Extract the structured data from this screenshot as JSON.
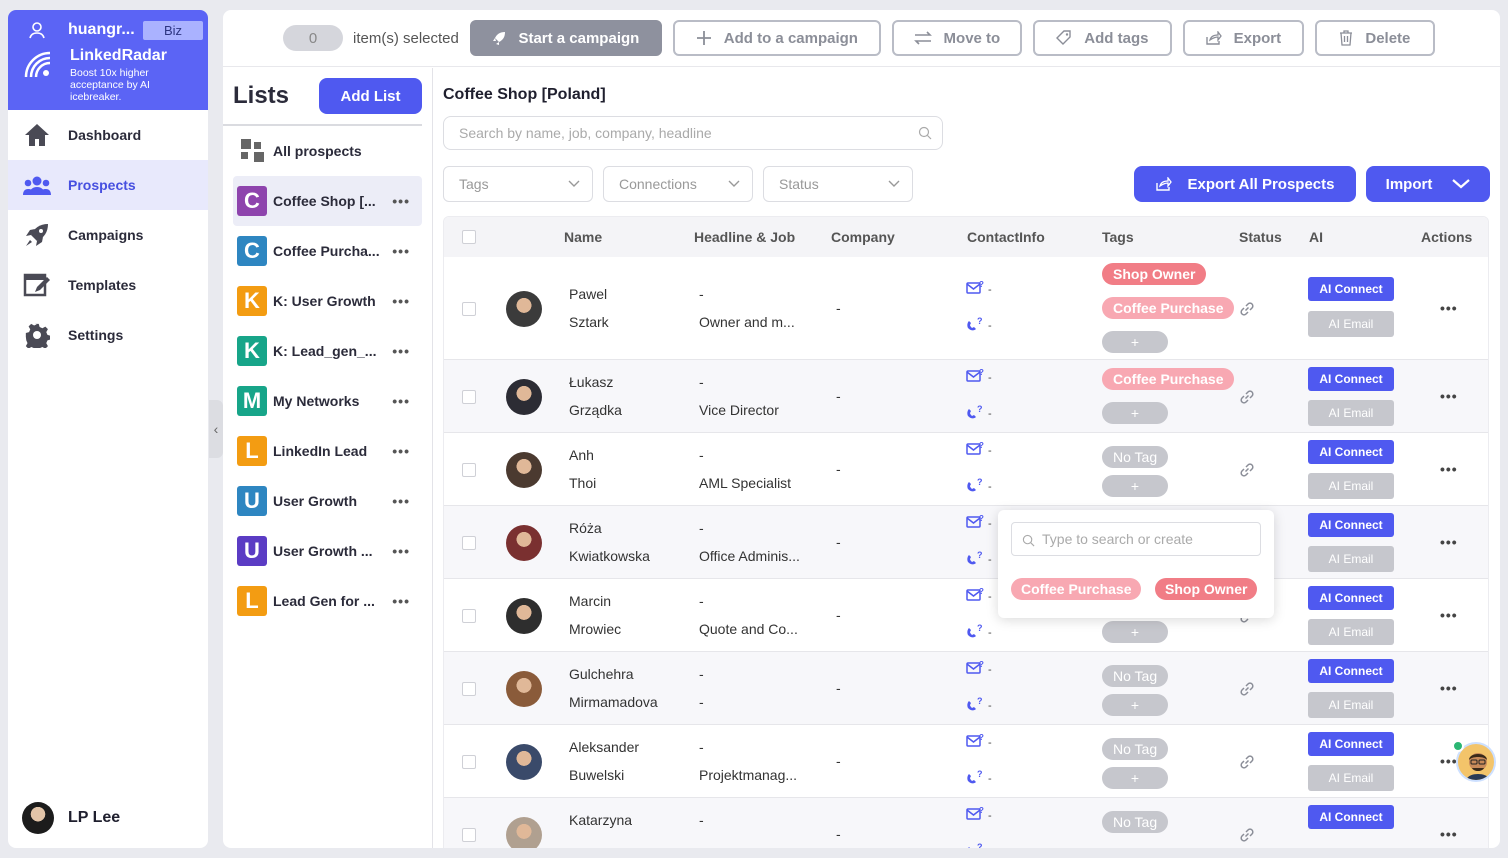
{
  "sidebar": {
    "username": "huangr...",
    "plan_badge": "Biz",
    "brand_name": "LinkedRadar",
    "brand_tagline": "Boost 10x higher acceptance by AI icebreaker.",
    "items": [
      {
        "label": "Dashboard",
        "icon": "home-icon"
      },
      {
        "label": "Prospects",
        "icon": "users-icon",
        "active": true
      },
      {
        "label": "Campaigns",
        "icon": "rocket-icon"
      },
      {
        "label": "Templates",
        "icon": "template-icon"
      },
      {
        "label": "Settings",
        "icon": "gear-icon"
      }
    ],
    "footer_user": "LP Lee"
  },
  "toolbar": {
    "selected_count": "0",
    "selected_label": "item(s) selected",
    "start_campaign": "Start a campaign",
    "add_to_campaign": "Add to a campaign",
    "move_to": "Move to",
    "add_tags": "Add tags",
    "export": "Export",
    "delete": "Delete"
  },
  "lists": {
    "title": "Lists",
    "add_button": "Add List",
    "all_prospects": "All prospects",
    "items": [
      {
        "letter": "C",
        "name": "Coffee Shop [...",
        "color": "#8e44ad",
        "active": true
      },
      {
        "letter": "C",
        "name": "Coffee Purcha...",
        "color": "#2e86c1"
      },
      {
        "letter": "K",
        "name": "K: User Growth",
        "color": "#f39c12"
      },
      {
        "letter": "K",
        "name": "K: Lead_gen_...",
        "color": "#17a589"
      },
      {
        "letter": "M",
        "name": "My Networks",
        "color": "#17a589"
      },
      {
        "letter": "L",
        "name": "LinkedIn Lead",
        "color": "#f39c12"
      },
      {
        "letter": "U",
        "name": "User Growth",
        "color": "#2e86c1"
      },
      {
        "letter": "U",
        "name": "User Growth ...",
        "color": "#5b3cc4"
      },
      {
        "letter": "L",
        "name": "Lead Gen for ...",
        "color": "#f39c12"
      }
    ]
  },
  "content": {
    "title": "Coffee Shop [Poland]",
    "search_placeholder": "Search by name, job, company, headline",
    "filters": [
      "Tags",
      "Connections",
      "Status"
    ],
    "export_all": "Export All Prospects",
    "import": "Import",
    "columns": [
      "Name",
      "Headline & Job",
      "Company",
      "ContactInfo",
      "Tags",
      "Status",
      "AI",
      "Actions"
    ],
    "ai_connect": "AI Connect",
    "ai_email": "AI Email",
    "dash": "-",
    "plus": "+",
    "no_tag": "No Tag",
    "rows": [
      {
        "first": "Pawel",
        "last": "Sztark",
        "headline": "-",
        "job": "Owner and m...",
        "company": "-",
        "tags": [
          "Shop Owner",
          "Coffee Purchase"
        ]
      },
      {
        "first": "Łukasz",
        "last": "Grządka",
        "headline": "-",
        "job": "Vice Director",
        "company": "-",
        "tags": [
          "Coffee Purchase"
        ]
      },
      {
        "first": "Anh",
        "last": "Thoi",
        "headline": "-",
        "job": "AML Specialist",
        "company": "-",
        "tags": []
      },
      {
        "first": "Róża",
        "last": "Kwiatkowska",
        "headline": "-",
        "job": "Office Adminis...",
        "company": "-",
        "tags": []
      },
      {
        "first": "Marcin",
        "last": "Mrowiec",
        "headline": "-",
        "job": "Quote and Co...",
        "company": "-",
        "tags": []
      },
      {
        "first": "Gulchehra",
        "last": "Mirmamadova",
        "headline": "-",
        "job": "-",
        "company": "-",
        "tags": []
      },
      {
        "first": "Aleksander",
        "last": "Buwelski",
        "headline": "-",
        "job": "Projektmanag...",
        "company": "-",
        "tags": []
      },
      {
        "first": "Katarzyna",
        "last": "",
        "headline": "-",
        "job": "",
        "company": "-",
        "tags": []
      }
    ]
  },
  "tag_popup": {
    "placeholder": "Type to search or create",
    "options": [
      "Coffee Purchase",
      "Shop Owner"
    ]
  },
  "colors": {
    "accent": "#4f59f0",
    "tag_shop_owner": "#f17d86",
    "tag_coffee_purchase": "#f8a8b2",
    "disabled": "#c6c7cd"
  }
}
